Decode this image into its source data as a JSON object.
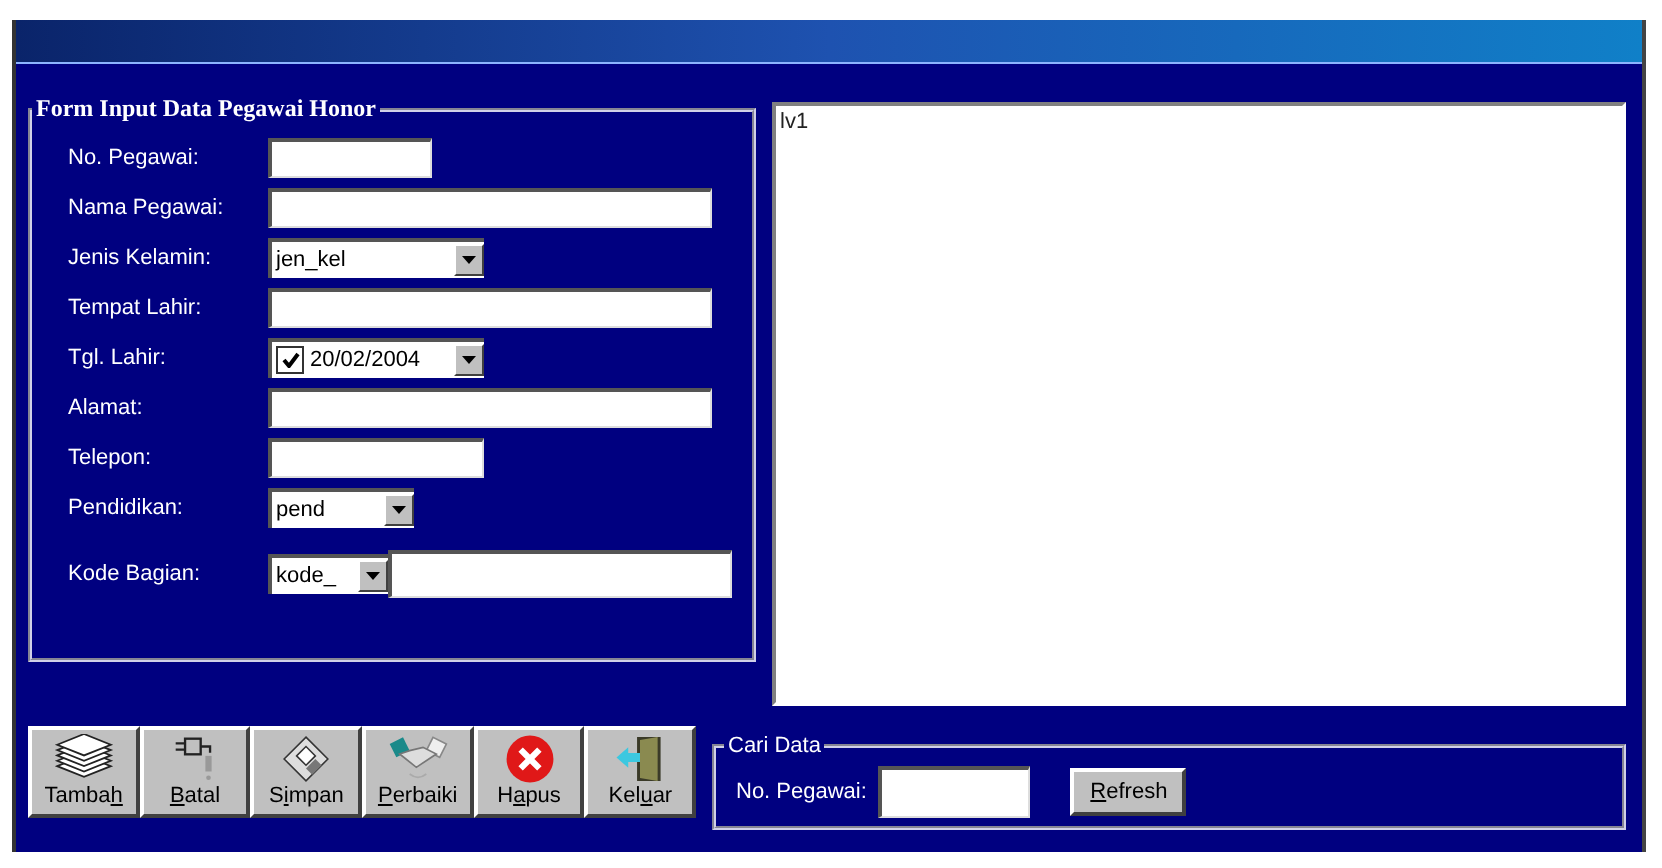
{
  "form": {
    "title": "Form Input Data Pegawai Honor",
    "fields": [
      {
        "kind": "text",
        "label": "No. Pegawai:"
      },
      {
        "kind": "text",
        "label": "Nama Pegawai:"
      },
      {
        "kind": "combo",
        "label": "Jenis Kelamin:",
        "value": "jen_kel"
      },
      {
        "kind": "text",
        "label": "Tempat Lahir:"
      },
      {
        "kind": "date",
        "label": "Tgl. Lahir:",
        "value": "20/02/2004",
        "checked": true
      },
      {
        "kind": "text",
        "label": "Alamat:"
      },
      {
        "kind": "text",
        "label": "Telepon:"
      },
      {
        "kind": "combo",
        "label": "Pendidikan:",
        "value": "pend"
      },
      {
        "kind": "combo_text",
        "label": "Kode Bagian:",
        "value": "kode_"
      }
    ]
  },
  "list_view": {
    "caption": "lv1"
  },
  "buttons": [
    {
      "label": "Tambah"
    },
    {
      "label": "Batal"
    },
    {
      "label": "Simpan"
    },
    {
      "label": "Perbaiki"
    },
    {
      "label": "Hapus"
    },
    {
      "label": "Keluar"
    }
  ],
  "search": {
    "title": "Cari Data",
    "label": "No. Pegawai:",
    "button": {
      "label": "Refresh"
    }
  }
}
